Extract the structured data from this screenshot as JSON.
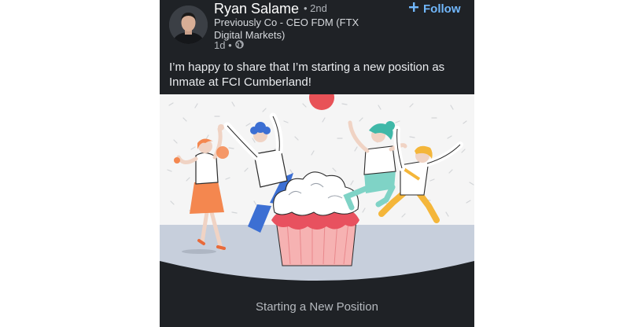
{
  "author": {
    "name": "Ryan Salame",
    "degree": "• 2nd",
    "headline": "Previously Co - CEO FDM (FTX Digital Markets)",
    "time": "1d •",
    "visibility_icon": "globe-icon"
  },
  "follow": {
    "label": "Follow",
    "icon": "plus-icon"
  },
  "post": {
    "text": "I’m happy to share that I’m starting a new position as Inmate at FCI Cumberland!"
  },
  "media": {
    "image_subject": "celebration-illustration",
    "caption": "Starting a New Position"
  },
  "colors": {
    "card_bg": "#1f2226",
    "accent": "#71b7fb",
    "ground": "#c7cfdc",
    "cupcake_frosting": "#e8515f",
    "red_sun": "#e85257"
  }
}
